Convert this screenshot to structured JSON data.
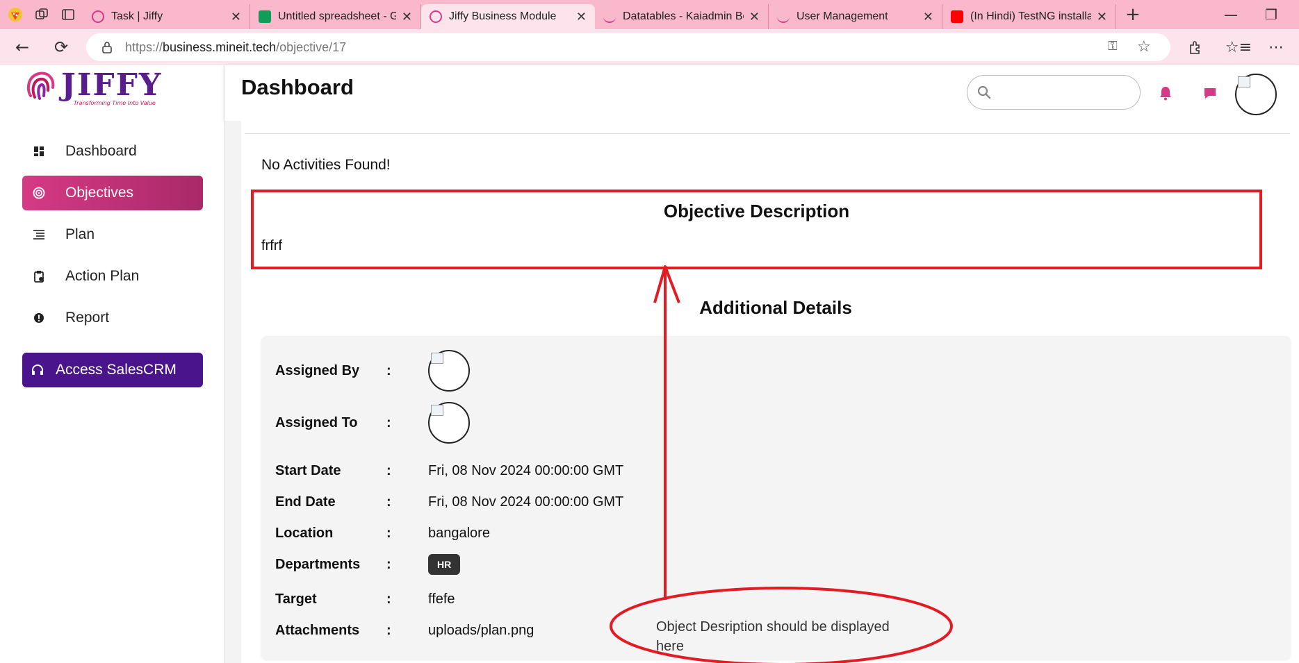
{
  "browser": {
    "tabs": [
      {
        "title": "Task | Jiffy",
        "favicon_color": "#d63a85",
        "active": false
      },
      {
        "title": "Untitled spreadsheet - Go",
        "favicon_color": "#0f9d58",
        "active": false
      },
      {
        "title": "Jiffy Business Module",
        "favicon_color": "#d63a85",
        "active": true
      },
      {
        "title": "Datatables - Kaiadmin Bo",
        "favicon_color": "#d63a85",
        "active": false
      },
      {
        "title": "User Management",
        "favicon_color": "#d63a85",
        "active": false
      },
      {
        "title": "(In Hindi) TestNG installati",
        "favicon_color": "#ff0000",
        "active": false
      }
    ],
    "url": {
      "prefix": "https://",
      "host": "business.mineit.tech",
      "path": "/objective/17"
    }
  },
  "sidebar": {
    "logo_text": "JIFFY",
    "logo_tagline": "Transforming Time Into Value",
    "items": [
      {
        "label": "Dashboard",
        "icon": "dashboard-icon",
        "active": false
      },
      {
        "label": "Objectives",
        "icon": "target-icon",
        "active": true
      },
      {
        "label": "Plan",
        "icon": "list-icon",
        "active": false
      },
      {
        "label": "Action Plan",
        "icon": "clipboard-icon",
        "active": false
      },
      {
        "label": "Report",
        "icon": "report-icon",
        "active": false
      }
    ],
    "crm_button": "Access SalesCRM"
  },
  "header": {
    "title": "Dashboard",
    "search_placeholder": ""
  },
  "main": {
    "no_activities": "No Activities Found!",
    "objective_description": {
      "title": "Objective Description",
      "text": "frfrf"
    },
    "additional_details": {
      "title": "Additional Details",
      "rows": {
        "assigned_by": {
          "label": "Assigned By",
          "colon": ":"
        },
        "assigned_to": {
          "label": "Assigned To",
          "colon": ":"
        },
        "start_date": {
          "label": "Start Date",
          "colon": ":",
          "value": "Fri, 08 Nov 2024 00:00:00 GMT"
        },
        "end_date": {
          "label": "End Date",
          "colon": ":",
          "value": "Fri, 08 Nov 2024 00:00:00 GMT"
        },
        "location": {
          "label": "Location",
          "colon": ":",
          "value": "bangalore"
        },
        "departments": {
          "label": "Departments",
          "colon": ":",
          "value": "HR"
        },
        "target": {
          "label": "Target",
          "colon": ":",
          "value": "ffefe"
        },
        "attachments": {
          "label": "Attachments",
          "colon": ":",
          "value": "uploads/plan.png"
        }
      }
    }
  },
  "annotation": {
    "note": "Object Desription should be displayed here",
    "color": "#e31b23"
  },
  "colors": {
    "brand_pink": "#d63a85",
    "brand_purple": "#4a148c",
    "tab_strip": "#f9b8cc",
    "annotation_red": "#e31b23"
  }
}
